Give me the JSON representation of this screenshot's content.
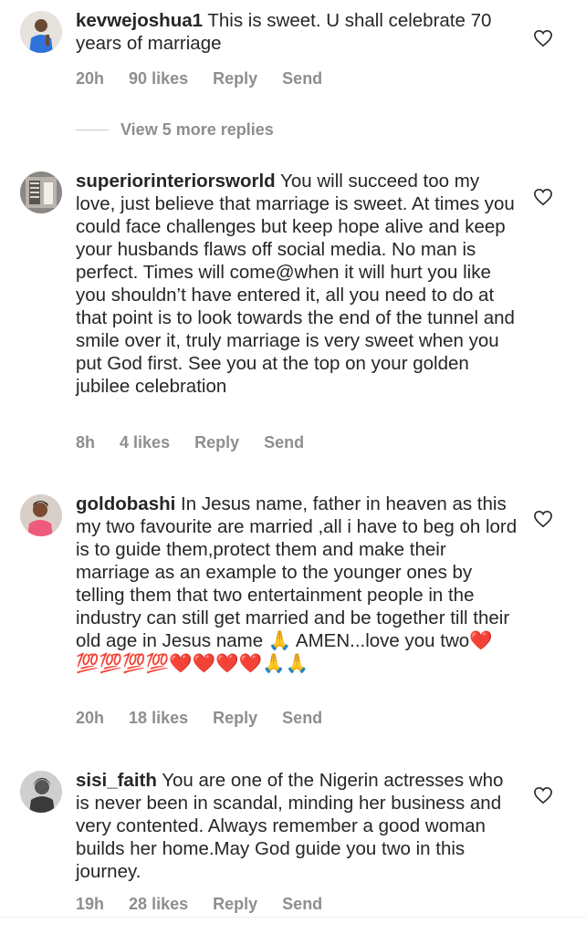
{
  "comments": [
    {
      "username": "kevwejoshua1",
      "text": " This is sweet. U shall celebrate 70 years of marriage",
      "time": "20h",
      "likes": "90 likes",
      "reply": "Reply",
      "send": "Send"
    },
    {
      "username": "superiorinteriorsworld",
      "text": " You will succeed too my love, just believe that marriage is sweet. At times you could face challenges but keep hope alive and keep your husbands flaws off social media. No man is perfect. Times will come@when it will hurt you like you shouldn’t have entered it, all you need to do at that point is to look towards the end of the tunnel and smile over it, truly marriage is very sweet when you put God first. See you at the top on your golden jubilee celebration",
      "time": "8h",
      "likes": "4 likes",
      "reply": "Reply",
      "send": "Send"
    },
    {
      "username": "goldobashi",
      "text": " In Jesus name, father in heaven as this my two favourite are married ,all i have to beg oh lord is to guide  them,protect them and make their marriage as an example to the younger ones by telling them that two entertainment people in the industry can still get married and be together till their old age in Jesus name 🙏 AMEN...love you two❤️ 💯💯💯💯❤️❤️❤️❤️🙏🙏",
      "time": "20h",
      "likes": "18 likes",
      "reply": "Reply",
      "send": "Send"
    },
    {
      "username": "sisi_faith",
      "text": " You are one of the Nigerin  actresses who is never been in scandal, minding her business and very contented.  Always remember a good woman builds her home.May God guide you two in this journey.",
      "time": "19h",
      "likes": "28 likes",
      "reply": "Reply",
      "send": "Send"
    }
  ],
  "view_more_replies": "View 5 more replies",
  "colors": {
    "text": "#262626",
    "meta": "#8e8e8e",
    "divider": "#c7c7c7"
  }
}
